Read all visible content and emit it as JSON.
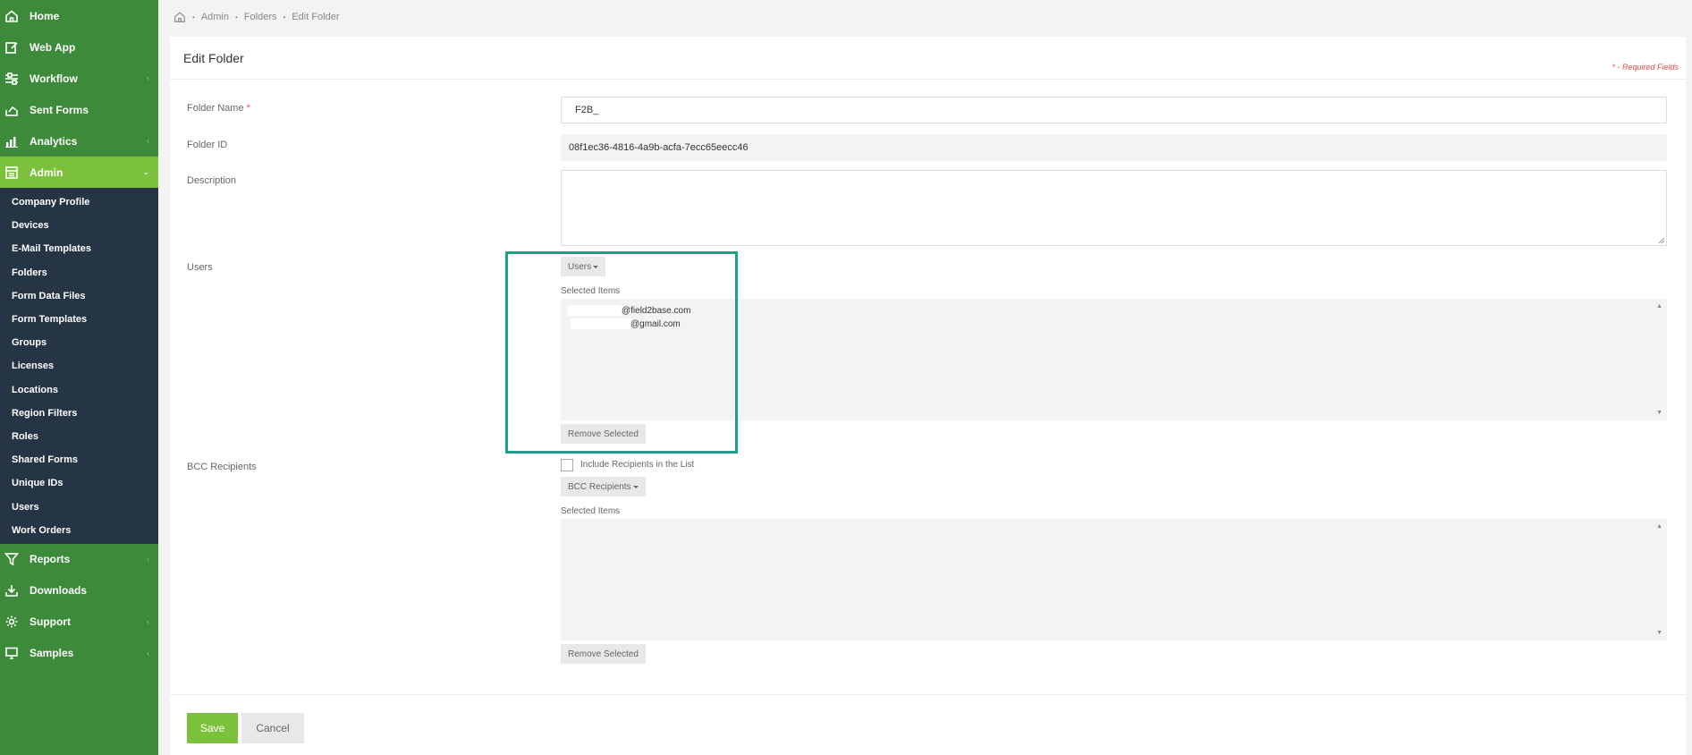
{
  "sidebar": {
    "items_top": [
      {
        "label": "Home",
        "icon": "home-icon",
        "chevron": false
      },
      {
        "label": "Web App",
        "icon": "edit-icon",
        "chevron": false
      },
      {
        "label": "Workflow",
        "icon": "workflow-icon",
        "chevron": true
      },
      {
        "label": "Sent Forms",
        "icon": "sent-forms-icon",
        "chevron": false
      },
      {
        "label": "Analytics",
        "icon": "analytics-icon",
        "chevron": true
      }
    ],
    "admin": {
      "label": "Admin",
      "icon": "admin-icon"
    },
    "admin_sub": [
      "Company Profile",
      "Devices",
      "E-Mail Templates",
      "Folders",
      "Form Data Files",
      "Form Templates",
      "Groups",
      "Licenses",
      "Locations",
      "Region Filters",
      "Roles",
      "Shared Forms",
      "Unique IDs",
      "Users",
      "Work Orders"
    ],
    "items_bottom": [
      {
        "label": "Reports",
        "icon": "filter-icon",
        "chevron": true
      },
      {
        "label": "Downloads",
        "icon": "download-icon",
        "chevron": false
      },
      {
        "label": "Support",
        "icon": "gear-icon",
        "chevron": true
      },
      {
        "label": "Samples",
        "icon": "monitor-icon",
        "chevron": true
      }
    ]
  },
  "breadcrumb": {
    "items": [
      "Admin",
      "Folders",
      "Edit Folder"
    ]
  },
  "form": {
    "title": "Edit Folder",
    "required_note": "* - Required Fields",
    "folder_name_label": "Folder Name",
    "folder_name_value": "F2B_",
    "folder_id_label": "Folder ID",
    "folder_id_value": "08f1ec36-4816-4a9b-acfa-7ecc65eecc46",
    "description_label": "Description",
    "users_label": "Users",
    "users_button": "Users",
    "users_selected_label": "Selected Items",
    "users_selected": [
      "@field2base.com",
      "@gmail.com"
    ],
    "users_remove": "Remove Selected",
    "bcc_label": "BCC Recipients",
    "bcc_include_label": "Include Recipients in the List",
    "bcc_button": "BCC Recipients",
    "bcc_selected_label": "Selected Items",
    "bcc_remove": "Remove Selected",
    "save": "Save",
    "cancel": "Cancel"
  },
  "colors": {
    "sidebar": "#3d8a3a",
    "active": "#7cc13c",
    "submenu": "#253545",
    "highlight": "#1e9f87",
    "required": "#e84c4c"
  }
}
